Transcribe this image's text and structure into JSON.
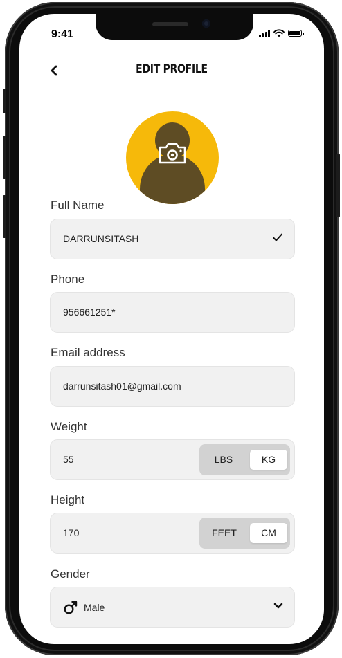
{
  "status_bar": {
    "time": "9:41"
  },
  "header": {
    "title": "EDIT PROFILE"
  },
  "form": {
    "full_name": {
      "label": "Full Name",
      "value": "DARRUNSITASH"
    },
    "phone": {
      "label": "Phone",
      "value": "956661251*"
    },
    "email": {
      "label": "Email address",
      "value": "darrunsitash01@gmail.com"
    },
    "weight": {
      "label": "Weight",
      "value": "55",
      "units": [
        "LBS",
        "KG"
      ],
      "selected_unit": "KG"
    },
    "height": {
      "label": "Height",
      "value": "170",
      "units": [
        "FEET",
        "CM"
      ],
      "selected_unit": "CM"
    },
    "gender": {
      "label": "Gender",
      "value": "Male"
    }
  },
  "colors": {
    "accent": "#f6b90a",
    "avatar_silhouette": "#5e4c24",
    "field_bg": "#f1f1f1",
    "toggle_bg": "#d2d2d2"
  },
  "icons": [
    "back-chevron-icon",
    "camera-icon",
    "checkmark-icon",
    "male-icon",
    "chevron-down-icon",
    "signal-icon",
    "wifi-icon",
    "battery-icon"
  ]
}
